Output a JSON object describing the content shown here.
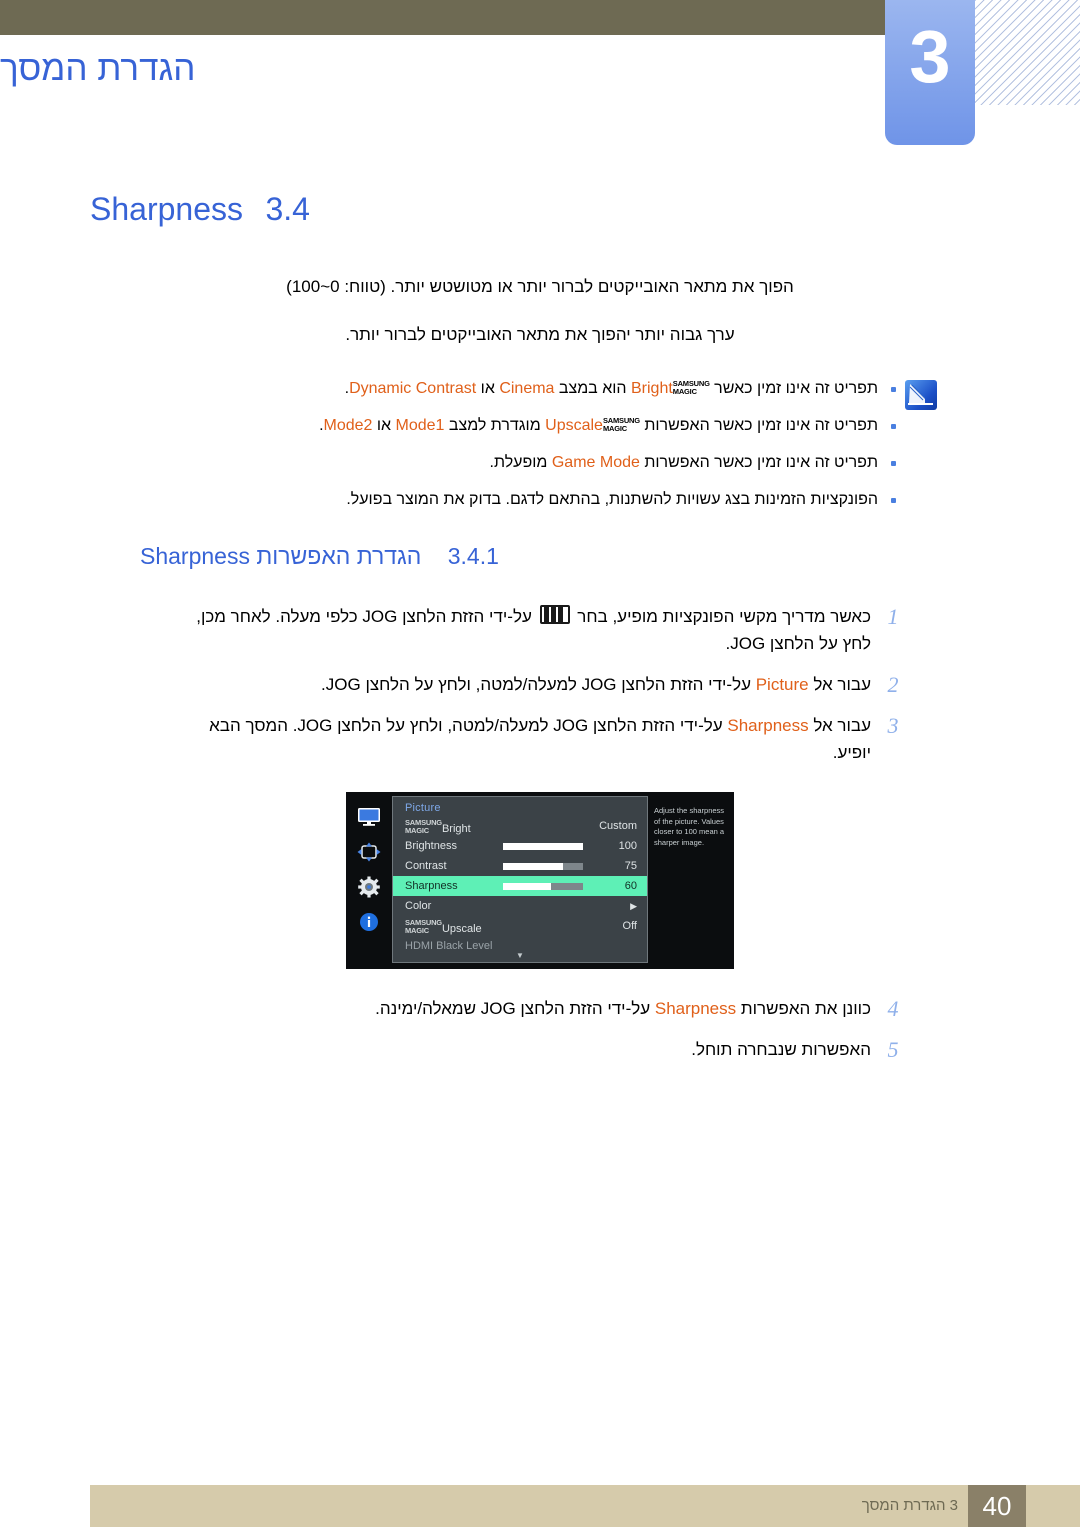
{
  "header": {
    "chapter_number": "3",
    "chapter_title": "הגדרת המסך"
  },
  "section": {
    "number": "3.4",
    "title": "Sharpness",
    "paragraph_1": "הפוך את מתאר האובייקטים לברור יותר או מטושטש יותר. (טווח: 0~100)",
    "paragraph_2": "ערך גבוה יותר יהפוך את מתאר האובייקטים לברור יותר."
  },
  "notes": {
    "icon_name": "note-pen-icon",
    "items": [
      {
        "prefix": "תפריט זה אינו זמין כאשר ",
        "magic": "MAGIC",
        "magic_top": "SAMSUNG",
        "term1": "Bright",
        "mid": " הוא במצב ",
        "term2": "Cinema",
        "conj": " או ",
        "term3": "Dynamic Contrast",
        "suffix": "."
      },
      {
        "prefix": "תפריט זה אינו זמין כאשר האפשרות ",
        "magic": "MAGIC",
        "magic_top": "SAMSUNG",
        "term1": "Upscale",
        "mid": " מוגדרת למצב ",
        "term2": "Mode1",
        "conj": " או ",
        "term3": "Mode2",
        "suffix": "."
      },
      {
        "prefix": "תפריט זה אינו זמין כאשר האפשרות ",
        "term1": "Game Mode",
        "mid": " מופעלת.",
        "term2": "",
        "conj": "",
        "term3": "",
        "suffix": ""
      },
      {
        "plain": "הפונקציות הזמינות בצג עשויות להשתנות, בהתאם לדגם. בדוק את המוצר בפועל."
      }
    ]
  },
  "subsection": {
    "number": "3.4.1",
    "title_he": "הגדרת האפשרות",
    "title_en": "Sharpness"
  },
  "steps": [
    {
      "num": "1",
      "part_a": "כאשר מדריך מקשי הפונקציות מופיע, בחר ",
      "glyph": "menu-bars-icon",
      "part_b": " על-ידי הזזת הלחצן JOG כלפי מעלה. לאחר מכן, לחץ על הלחצן JOG."
    },
    {
      "num": "2",
      "part_a": "עבור אל ",
      "term": "Picture",
      "part_b": " על-ידי הזזת הלחצן JOG למעלה/למטה, ולחץ על הלחצן JOG."
    },
    {
      "num": "3",
      "part_a": "עבור אל ",
      "term": "Sharpness",
      "part_b": " על-ידי הזזת הלחצן JOG למעלה/למטה, ולחץ על הלחצן JOG. המסך הבא יופיע."
    },
    {
      "num": "4",
      "part_a": "כוונן את האפשרות ",
      "term": "Sharpness",
      "part_b": " על-ידי הזזת הלחצן JOG שמאלה/ימינה."
    },
    {
      "num": "5",
      "part_a": "האפשרות שנבחרה תוחל.",
      "term": "",
      "part_b": ""
    }
  ],
  "osd": {
    "rail_icons": [
      "monitor-icon",
      "four-way-arrows-icon",
      "gear-icon",
      "info-icon"
    ],
    "menu_title": "Picture",
    "rows": [
      {
        "label": "Bright",
        "magic": "MAGIC",
        "magic_top": "SAMSUNG",
        "value": "Custom",
        "bar": null,
        "state": "normal"
      },
      {
        "label": "Brightness",
        "value": "100",
        "bar": 100,
        "state": "normal"
      },
      {
        "label": "Contrast",
        "value": "75",
        "bar": 75,
        "state": "normal"
      },
      {
        "label": "Sharpness",
        "value": "60",
        "bar": 60,
        "state": "selected"
      },
      {
        "label": "Color",
        "value": "▶",
        "bar": null,
        "state": "normal"
      },
      {
        "label": "Upscale",
        "magic": "MAGIC",
        "magic_top": "SAMSUNG",
        "value": "Off",
        "bar": null,
        "state": "normal"
      },
      {
        "label": "HDMI Black Level",
        "value": "",
        "bar": null,
        "state": "dim"
      }
    ],
    "scroll_down": "▼",
    "help_text": "Adjust the sharpness of the picture. Values closer to 100 mean a sharper image."
  },
  "footer": {
    "chapter_label": "3 הגדרת המסך",
    "page_number": "40"
  },
  "colors": {
    "heading_blue": "#3763d6",
    "keyword_orange": "#e0601a",
    "header_bar": "#6e6a53",
    "chapter_tab": "#6f94e8",
    "osd_highlight": "#5ef0b6",
    "footer_band": "#d6cbab",
    "footer_page_box": "#8a8068"
  }
}
